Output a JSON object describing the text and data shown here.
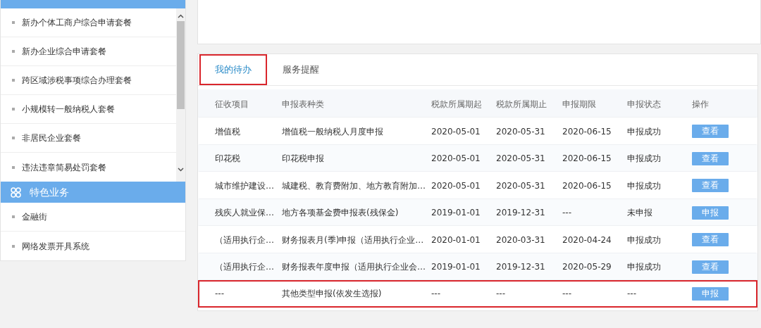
{
  "sidebar": {
    "sections": [
      {
        "items": [
          {
            "label": "新办个体工商户综合申请套餐"
          },
          {
            "label": "新办企业综合申请套餐"
          },
          {
            "label": "跨区域涉税事项综合办理套餐"
          },
          {
            "label": "小规模转一般纳税人套餐"
          },
          {
            "label": "非居民企业套餐"
          },
          {
            "label": "违法违章简易处罚套餐"
          }
        ],
        "scrollable": true
      },
      {
        "title": "特色业务",
        "items": [
          {
            "label": "金融街"
          },
          {
            "label": "网络发票开具系统"
          }
        ],
        "scrollable": false
      }
    ]
  },
  "tabs": [
    {
      "label": "我的待办",
      "selected": true,
      "highlighted": true
    },
    {
      "label": "服务提醒",
      "selected": false,
      "highlighted": false
    }
  ],
  "table": {
    "columns": [
      "征收项目",
      "申报表种类",
      "税款所属期起",
      "税款所属期止",
      "申报期限",
      "申报状态",
      "操作"
    ],
    "rows": [
      {
        "cells": [
          "增值税",
          "增值税一般纳税人月度申报",
          "2020-05-01",
          "2020-05-31",
          "2020-06-15",
          "申报成功"
        ],
        "action": "查看",
        "highlighted": false
      },
      {
        "cells": [
          "印花税",
          "印花税申报",
          "2020-05-01",
          "2020-05-31",
          "2020-06-15",
          "申报成功"
        ],
        "action": "查看",
        "highlighted": false
      },
      {
        "cells": [
          "城市维护建设…",
          "城建税、教育费附加、地方教育附加…",
          "2020-05-01",
          "2020-05-31",
          "2020-06-15",
          "申报成功"
        ],
        "action": "查看",
        "highlighted": false
      },
      {
        "cells": [
          "残疾人就业保…",
          "地方各项基金费申报表(残保金)",
          "2019-01-01",
          "2019-12-31",
          "---",
          "未申报"
        ],
        "action": "申报",
        "highlighted": false
      },
      {
        "cells": [
          "（适用执行企…",
          "财务报表月(季)申报（适用执行企业…",
          "2020-01-01",
          "2020-03-31",
          "2020-04-24",
          "申报成功"
        ],
        "action": "查看",
        "highlighted": false
      },
      {
        "cells": [
          "（适用执行企…",
          "财务报表年度申报（适用执行企业会…",
          "2019-01-01",
          "2019-12-31",
          "2020-05-29",
          "申报成功"
        ],
        "action": "查看",
        "highlighted": false
      },
      {
        "cells": [
          "---",
          "其他类型申报(依发生选报)",
          "---",
          "---",
          "---",
          "---"
        ],
        "action": "申报",
        "highlighted": true
      }
    ]
  }
}
